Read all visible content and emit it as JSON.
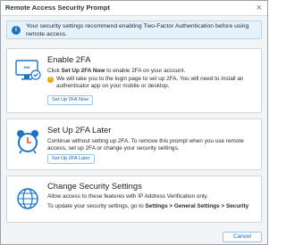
{
  "window": {
    "title": "Remote Access Security Prompt",
    "close_glyph": "×"
  },
  "banner": {
    "icon": "info-icon",
    "text": "Your security settings recommend enabling Two-Factor Authentication before using remote access."
  },
  "options": [
    {
      "icon": "monitor-2fa-icon",
      "title": "Enable 2FA",
      "text_pre": "Click ",
      "text_bold": "Set Up 2FA Now",
      "text_post": " to enable 2FA on your account.",
      "warning_icon": "warning-icon",
      "warning_text": "We will take you to the login page to set up 2FA. You will need to install an authenticator app on your mobile or desktop.",
      "button_label": "Set Up 2FA Now"
    },
    {
      "icon": "alarm-clock-icon",
      "title": "Set Up 2FA Later",
      "text": "Continue without setting up 2FA. To remove this prompt when you use remote access, set up 2FA or change your security settings.",
      "button_label": "Set Up 2FA Later"
    },
    {
      "icon": "globe-icon",
      "title": "Change Security Settings",
      "text": "Allow access to these features with IP Address Verification only.",
      "text2_pre": "To update your security settings, go to ",
      "text2_bold": "Settings > General Settings > Security"
    }
  ],
  "footer": {
    "cancel_label": "Cancel"
  },
  "colors": {
    "accent": "#1e73be",
    "banner_bg": "#e6f2fb",
    "warning": "#f0a30a",
    "alarm_red": "#e94b3c"
  }
}
